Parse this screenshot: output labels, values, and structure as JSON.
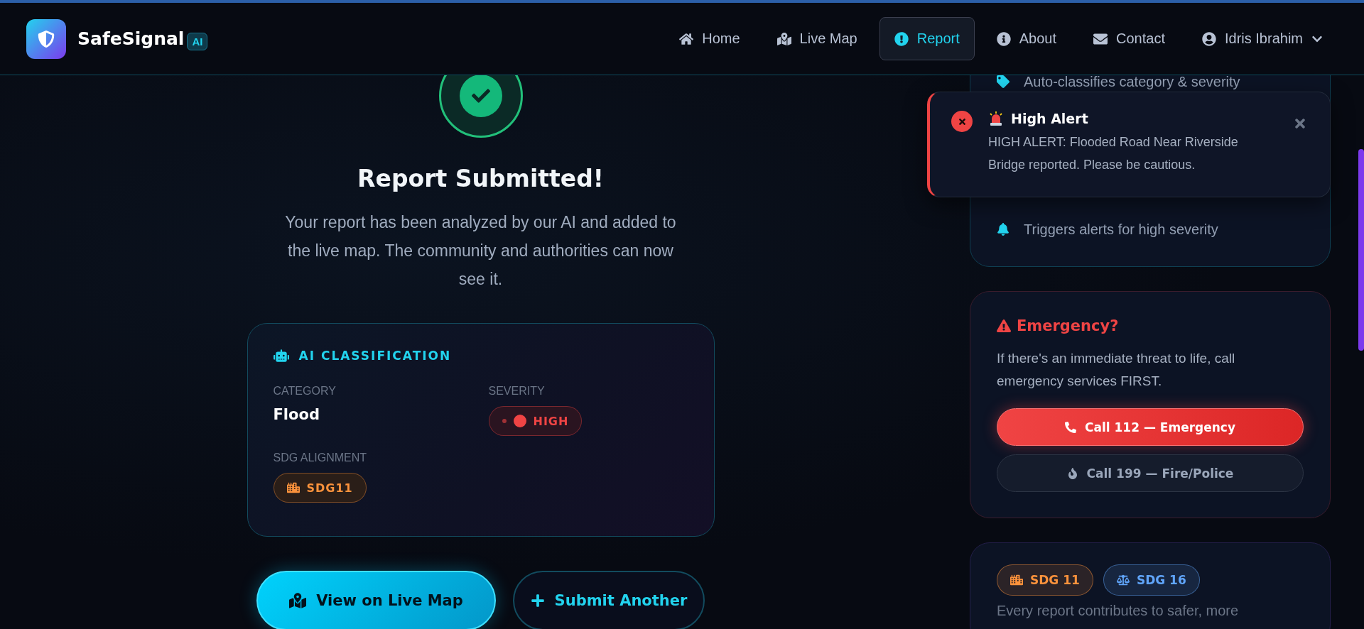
{
  "header": {
    "brand": "SafeSignal",
    "brand_badge": "AI",
    "nav": [
      {
        "label": "Home",
        "kind": "home",
        "selected": false
      },
      {
        "label": "Live Map",
        "kind": "map",
        "selected": false
      },
      {
        "label": "Report",
        "kind": "alert",
        "selected": true
      },
      {
        "label": "About",
        "kind": "info",
        "selected": false
      },
      {
        "label": "Contact",
        "kind": "mail",
        "selected": false
      }
    ],
    "user": {
      "name": "Idris Ibrahim"
    }
  },
  "success": {
    "title": "Report Submitted!",
    "message": "Your report has been analyzed by our AI and added to the live map. The community and authorities can now see it."
  },
  "classification": {
    "title": "AI CLASSIFICATION",
    "fields": [
      {
        "label": "CATEGORY",
        "value": "Flood",
        "kind": "text"
      },
      {
        "label": "SEVERITY",
        "value": "HIGH",
        "kind": "severity"
      },
      {
        "label": "SDG ALIGNMENT",
        "value": "SDG11",
        "kind": "sdg"
      }
    ]
  },
  "actions": [
    {
      "label": "View on Live Map",
      "kind": "primary"
    },
    {
      "label": "Submit Another",
      "kind": "secondary"
    }
  ],
  "features": {
    "items": [
      {
        "label": "Auto-classifies category & severity",
        "kind": "tag"
      },
      {
        "label": "Triggers alerts for high severity",
        "kind": "bell"
      }
    ]
  },
  "emergency": {
    "title": "Emergency?",
    "message": "If there's an immediate threat to life, call emergency services FIRST.",
    "buttons": [
      {
        "label": "Call 112 — Emergency",
        "kind": "danger"
      },
      {
        "label": "Call 199 — Fire/Police",
        "kind": "muted"
      }
    ]
  },
  "sdg_card": {
    "tags": [
      {
        "label": "SDG 11",
        "kind": "city",
        "color": "#fb923c"
      },
      {
        "label": "SDG 16",
        "kind": "scale",
        "color": "#60a5fa"
      }
    ],
    "text": "Every report contributes to safer, more"
  },
  "toast": {
    "title": "High Alert",
    "message": "HIGH ALERT: Flooded Road Near Riverside Bridge reported. Please be cautious."
  }
}
